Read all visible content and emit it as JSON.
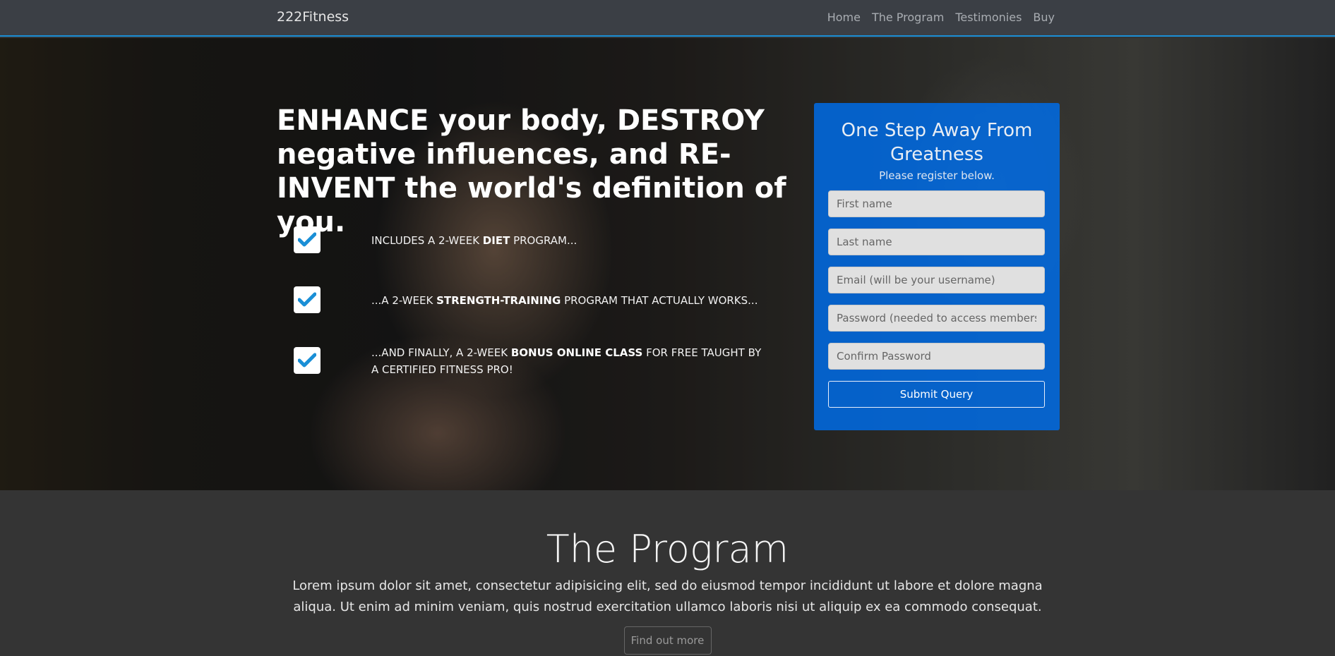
{
  "nav": {
    "brand": "222Fitness",
    "links": [
      "Home",
      "The Program",
      "Testimonies",
      "Buy"
    ]
  },
  "hero": {
    "headline": {
      "w1": "ENHANCE",
      "t1": " your body, ",
      "w2": "DESTROY",
      "t2": " negative influences, and ",
      "w3": "RE-INVENT",
      "t3": " the world's definition of you."
    },
    "features": [
      {
        "pre": "Includes a 2-week ",
        "bold": "diet",
        "post": " program..."
      },
      {
        "pre": "...A 2-week ",
        "bold": "strength-training",
        "post": " program that actually works..."
      },
      {
        "pre": "...And finally, a 2-week ",
        "bold": "bonus online class",
        "post": " for free taught by a certified fitness pro!"
      }
    ]
  },
  "form": {
    "title": "One Step Away From Greatness",
    "subtitle": "Please register below.",
    "first_name_placeholder": "First name",
    "last_name_placeholder": "Last name",
    "email_placeholder": "Email (will be your username)",
    "password_placeholder": "Password (needed to access members-o",
    "confirm_placeholder": "Confirm Password",
    "submit_label": "Submit Query",
    "accent_color": "#0a6fe8"
  },
  "program": {
    "title": "The Program",
    "body": "Lorem ipsum dolor sit amet, consectetur adipisicing elit, sed do eiusmod tempor incididunt ut labore et dolore magna aliqua. Ut enim ad minim veniam, quis nostrud exercitation ullamco laboris nisi ut aliquip ex ea commodo consequat.",
    "button_label": "Find out more"
  }
}
